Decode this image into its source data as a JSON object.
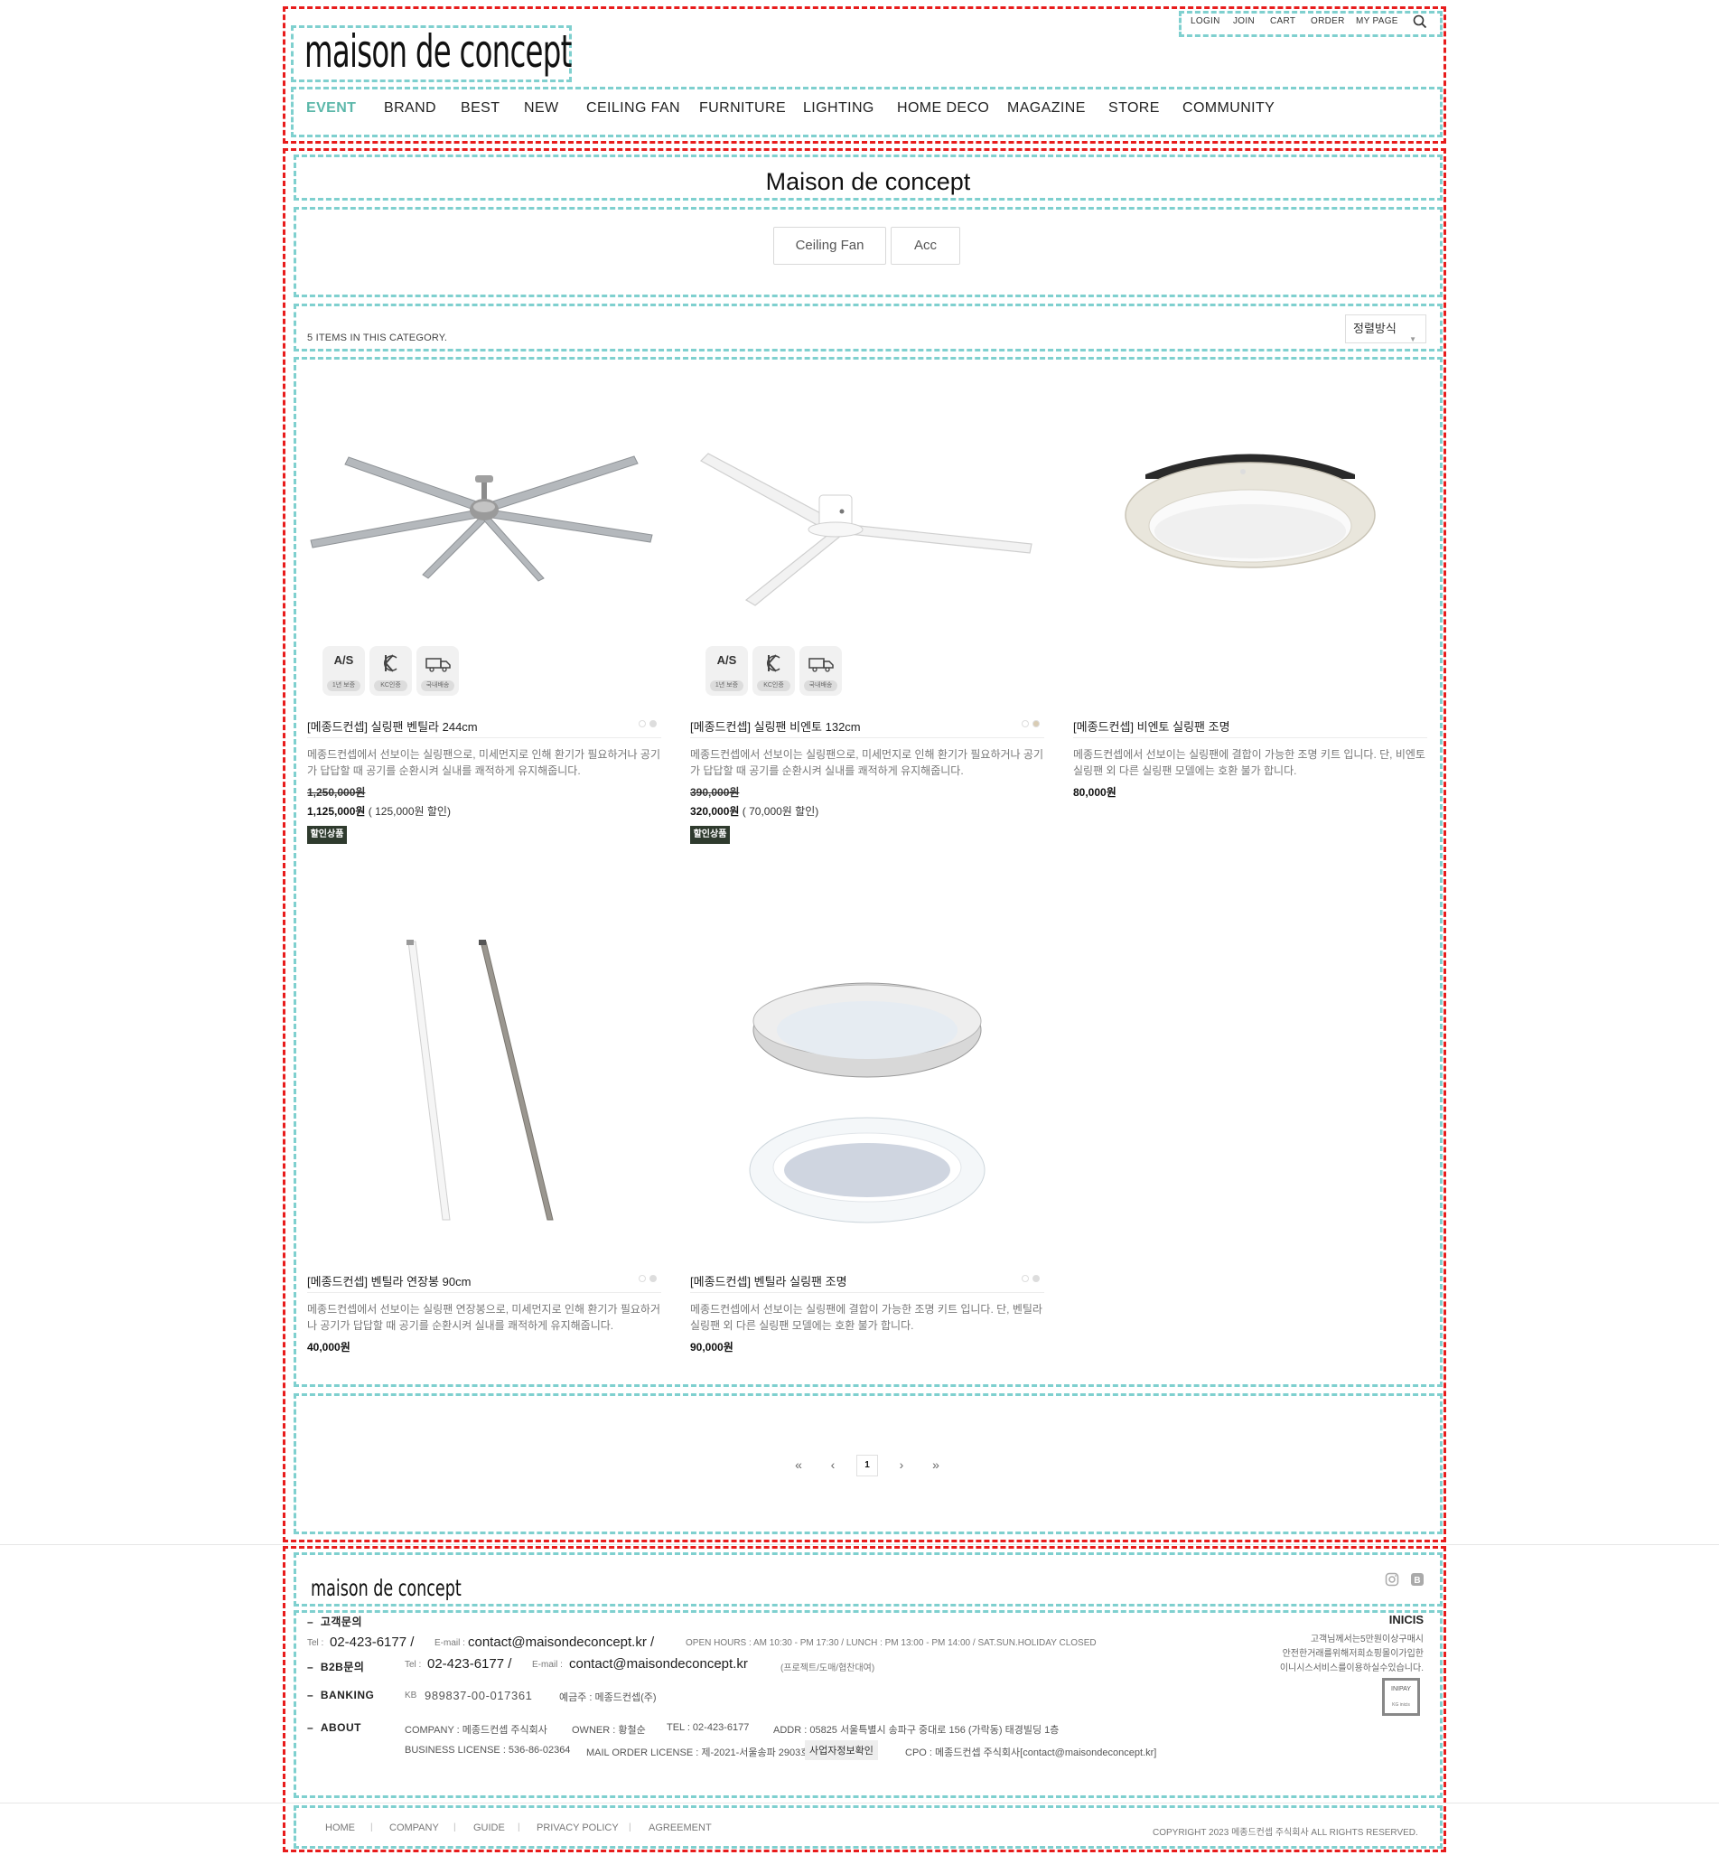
{
  "header": {
    "logo": "maison de concept",
    "util_links": [
      "LOGIN",
      "JOIN",
      "CART",
      "ORDER",
      "MY PAGE"
    ],
    "search_icon": "search-icon",
    "nav": [
      "EVENT",
      "BRAND",
      "BEST",
      "NEW",
      "CEILING FAN",
      "FURNITURE",
      "LIGHTING",
      "HOME DECO",
      "MAGAZINE",
      "STORE",
      "COMMUNITY"
    ],
    "active_color": "#5bb7a9"
  },
  "category": {
    "title": "Maison de concept",
    "tabs": [
      "Ceiling Fan",
      "Acc"
    ],
    "count_text": "5 ITEMS IN THIS CATEGORY.",
    "sort_label": "정렬방식"
  },
  "certs": {
    "as": {
      "top": "A/S",
      "bottom": "1년 보증"
    },
    "kc": {
      "bottom": "KC인증"
    },
    "delivery": {
      "bottom": "국내배송"
    }
  },
  "products": [
    {
      "name": "[메종드컨셉] 실링팬 벤틸라 244cm",
      "desc": "메종드컨셉에서 선보이는 실링팬으로, 미세먼지로 인해 환기가 필요하거나 공기가 답답할 때 공기를 순환시켜 실내를 쾌적하게 유지해줍니다.",
      "price_old": "1,250,000원",
      "price": "1,125,000원",
      "discount": "( 125,000원 할인)",
      "badge": "할인상품"
    },
    {
      "name": "[메종드컨셉] 실링팬 비엔토 132cm",
      "desc": "메종드컨셉에서 선보이는 실링팬으로, 미세먼지로 인해 환기가 필요하거나 공기가 답답할 때 공기를 순환시켜 실내를 쾌적하게 유지해줍니다.",
      "price_old": "390,000원",
      "price": "320,000원",
      "discount": "( 70,000원 할인)",
      "badge": "할인상품"
    },
    {
      "name": "[메종드컨셉] 비엔토 실링팬 조명",
      "desc": "메종드컨셉에서 선보이는 실링팬에 결합이 가능한 조명 키트 입니다. 단, 비엔토 실링팬 외 다른 실링팬 모델에는 호환 불가 합니다.",
      "price": "80,000원"
    },
    {
      "name": "[메종드컨셉] 벤틸라 연장봉 90cm",
      "desc": "메종드컨셉에서 선보이는 실링팬 연장봉으로, 미세먼지로 인해 환기가 필요하거나 공기가 답답할 때 공기를 순환시켜 실내를 쾌적하게 유지해줍니다.",
      "price": "40,000원"
    },
    {
      "name": "[메종드컨셉] 벤틸라 실링팬 조명",
      "desc": "메종드컨셉에서 선보이는 실링팬에 결합이 가능한 조명 키트 입니다. 단, 벤틸라 실링팬 외 다른 실링팬 모델에는 호환 불가 합니다.",
      "price": "90,000원"
    }
  ],
  "pagination": {
    "first": "«",
    "prev": "‹",
    "current": "1",
    "next": "›",
    "last": "»"
  },
  "footer": {
    "logo": "maison de concept",
    "social_icons": [
      "instagram-icon",
      "blog-icon"
    ],
    "cs": {
      "label": "고객문의",
      "tel_label": "Tel :",
      "tel": "02-423-6177 /",
      "email_label": "E-mail :",
      "email": "contact@maisondeconcept.kr /",
      "hours": "OPEN HOURS : AM 10:30 - PM 17:30 / LUNCH : PM 13:00 - PM 14:00 / SAT.SUN.HOLIDAY CLOSED"
    },
    "b2b": {
      "label": "B2B문의",
      "tel_label": "Tel :",
      "tel": "02-423-6177 /",
      "email_label": "E-mail :",
      "email": "contact@maisondeconcept.kr",
      "note": "(프로젝트/도매/협찬대여)"
    },
    "banking": {
      "label": "BANKING",
      "bank": "KB",
      "account": "989837-00-017361",
      "holder": "예금주 : 메종드컨셉(주)"
    },
    "about": {
      "label": "ABOUT",
      "company": "COMPANY : 메종드컨셉 주식회사",
      "owner": "OWNER : 황철순",
      "tel": "TEL : 02-423-6177",
      "addr": "ADDR : 05825 서울특별시 송파구 중대로 156 (가락동) 태경빌딩 1층",
      "license": "BUSINESS LICENSE : 536-86-02364",
      "mail_order": "MAIL ORDER LICENSE : 제-2021-서울송파 2903호",
      "biz_check_btn": "사업자정보확인",
      "cpo": "CPO : 메종드컨셉 주식회사[contact@maisondeconcept.kr]"
    },
    "inicis": {
      "title": "INICIS",
      "lines": [
        "고객님께서는5만원이상구매시",
        "안전한거래를위해저희쇼핑몰이가입한",
        "이니시스서비스를이용하실수있습니다."
      ],
      "mark_top": "INIPAY",
      "mark_bottom": "KG inicis"
    },
    "bottom_links": [
      "HOME",
      "COMPANY",
      "GUIDE",
      "PRIVACY POLICY",
      "AGREEMENT"
    ],
    "copyright": "COPYRIGHT 2023 메종드컨셉 주식회사 ALL RIGHTS RESERVED."
  }
}
